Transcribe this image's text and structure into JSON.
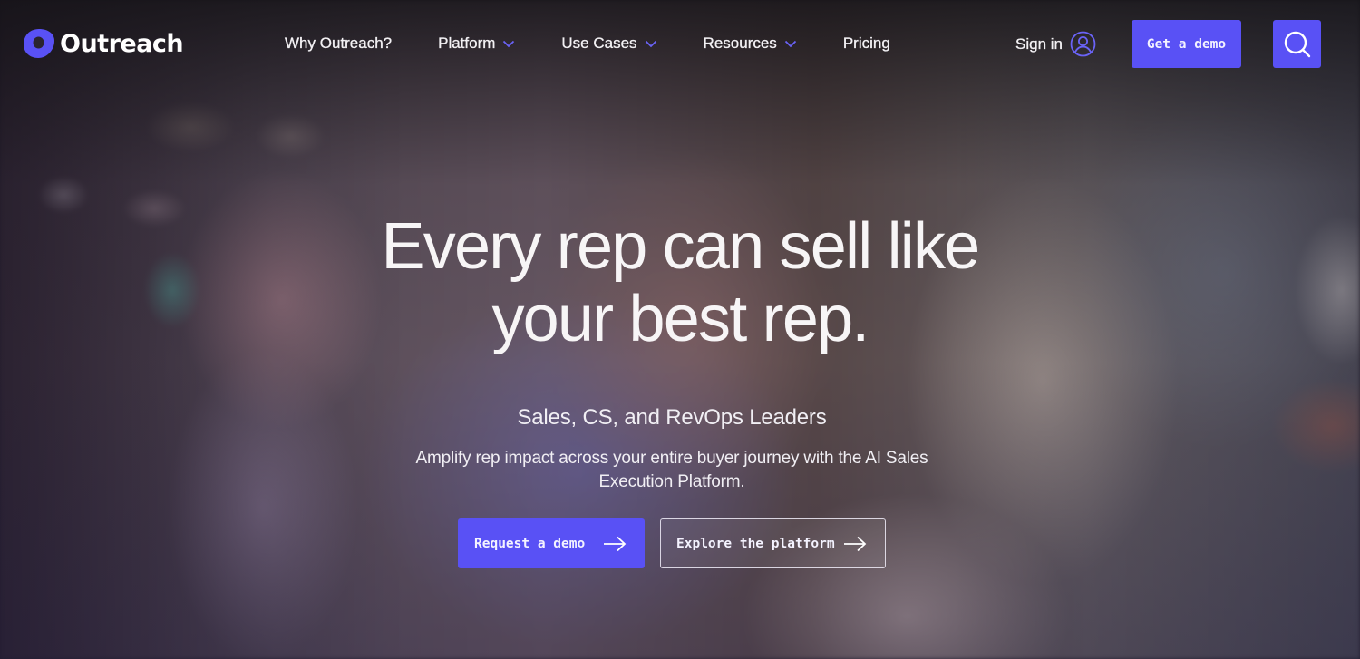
{
  "brand": {
    "name": "Outreach",
    "accent_color": "#5951f5",
    "logo_icon": "outreach-logo-mark"
  },
  "nav": {
    "items": [
      {
        "label": "Why Outreach?",
        "has_dropdown": false
      },
      {
        "label": "Platform",
        "has_dropdown": true
      },
      {
        "label": "Use Cases",
        "has_dropdown": true
      },
      {
        "label": "Resources",
        "has_dropdown": true
      },
      {
        "label": "Pricing",
        "has_dropdown": false
      }
    ],
    "dropdown_icon": "chevron-down-icon"
  },
  "header_actions": {
    "sign_in_label": "Sign in",
    "sign_in_icon": "user-circle-icon",
    "get_demo_label": "Get a demo",
    "search_icon": "search-icon"
  },
  "hero": {
    "title_lines": [
      "Every rep can sell like",
      "your best rep."
    ],
    "kicker": "Sales, CS, and RevOps Leaders",
    "subtitle": "Amplify rep impact across your entire buyer journey with the AI Sales Execution Platform.",
    "primary_cta": {
      "label": "Request a demo",
      "icon": "arrow-right-icon"
    },
    "secondary_cta": {
      "label": "Explore the platform",
      "icon": "arrow-right-icon"
    }
  }
}
